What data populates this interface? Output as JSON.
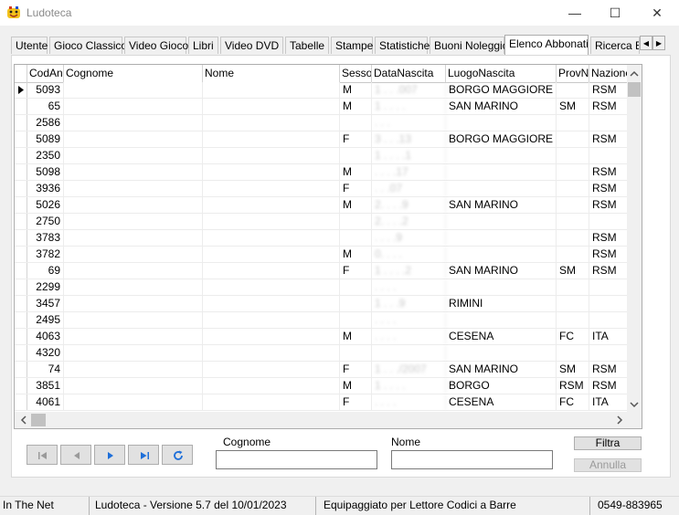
{
  "window": {
    "title": "Ludoteca",
    "minimize": "—",
    "maximize": "☐",
    "close": "✕"
  },
  "tabs": [
    {
      "label": "Utente"
    },
    {
      "label": "Gioco Classico"
    },
    {
      "label": "Video Gioco"
    },
    {
      "label": "Libri"
    },
    {
      "label": "Video DVD"
    },
    {
      "label": "Tabelle"
    },
    {
      "label": "Stampe"
    },
    {
      "label": "Statistiche"
    },
    {
      "label": "Buoni Noleggio"
    },
    {
      "label": "Elenco Abbonati"
    },
    {
      "label": "Ricerca E"
    }
  ],
  "active_tab": "Elenco Abbonati",
  "grid": {
    "columns": [
      "CodAna",
      "Cognome",
      "Nome",
      "Sesso",
      "DataNascita",
      "LuogoNascita",
      "ProvN",
      "Nazione"
    ],
    "rows": [
      {
        "cod": "5093",
        "sesso": "M",
        "data": "1 . . .007",
        "luogo": "BORGO MAGGIORE",
        "prov": "",
        "naz": "RSM"
      },
      {
        "cod": "65",
        "sesso": "M",
        "data": "1 . . . .",
        "luogo": "SAN MARINO",
        "prov": "SM",
        "naz": "RSM"
      },
      {
        "cod": "2586",
        "sesso": "",
        "data": ". . .",
        "luogo": "",
        "prov": "",
        "naz": ""
      },
      {
        "cod": "5089",
        "sesso": "F",
        "data": "3 . . .13",
        "luogo": "BORGO MAGGIORE",
        "prov": "",
        "naz": "RSM"
      },
      {
        "cod": "2350",
        "sesso": "",
        "data": "1 . . . .1",
        "luogo": "",
        "prov": "",
        "naz": ""
      },
      {
        "cod": "5098",
        "sesso": "M",
        "data": ". . . .17",
        "luogo": "",
        "prov": "",
        "naz": "RSM"
      },
      {
        "cod": "3936",
        "sesso": "F",
        "data": ". . .07",
        "luogo": "",
        "prov": "",
        "naz": "RSM"
      },
      {
        "cod": "5026",
        "sesso": "M",
        "data": "2. . . .9",
        "luogo": "SAN MARINO",
        "prov": "",
        "naz": "RSM"
      },
      {
        "cod": "2750",
        "sesso": "",
        "data": "2. . . .2",
        "luogo": "",
        "prov": "",
        "naz": ""
      },
      {
        "cod": "3783",
        "sesso": "",
        "data": ". . . .9",
        "luogo": "",
        "prov": "",
        "naz": "RSM"
      },
      {
        "cod": "3782",
        "sesso": "M",
        "data": "0. . . .",
        "luogo": "",
        "prov": "",
        "naz": "RSM"
      },
      {
        "cod": "69",
        "sesso": "F",
        "data": "1 . . . .2",
        "luogo": "SAN MARINO",
        "prov": "SM",
        "naz": "RSM"
      },
      {
        "cod": "2299",
        "sesso": "",
        "data": ". . . .",
        "luogo": "",
        "prov": "",
        "naz": ""
      },
      {
        "cod": "3457",
        "sesso": "",
        "data": "1 . . .9",
        "luogo": "RIMINI",
        "prov": "",
        "naz": ""
      },
      {
        "cod": "2495",
        "sesso": "",
        "data": ". . . .",
        "luogo": "",
        "prov": "",
        "naz": ""
      },
      {
        "cod": "4063",
        "sesso": "M",
        "data": ". . . .",
        "luogo": "CESENA",
        "prov": "FC",
        "naz": "ITA"
      },
      {
        "cod": "4320",
        "sesso": "",
        "data": "",
        "luogo": "",
        "prov": "",
        "naz": ""
      },
      {
        "cod": "74",
        "sesso": "F",
        "data": "1 . . ./2007",
        "luogo": "SAN MARINO",
        "prov": "SM",
        "naz": "RSM"
      },
      {
        "cod": "3851",
        "sesso": "M",
        "data": "1 . . . .",
        "luogo": "BORGO",
        "prov": "RSM",
        "naz": "RSM"
      },
      {
        "cod": "4061",
        "sesso": "F",
        "data": ". . . .",
        "luogo": "CESENA",
        "prov": "FC",
        "naz": "ITA"
      }
    ]
  },
  "filter": {
    "cognome_label": "Cognome",
    "nome_label": "Nome",
    "cognome_value": "",
    "nome_value": "",
    "filtra_label": "Filtra",
    "annulla_label": "Annulla"
  },
  "status": {
    "company": "In The Net",
    "version": "Ludoteca - Versione 5.7 del 10/01/2023",
    "feature": "Equipaggiato per Lettore Codici a Barre",
    "phone": "0549-883965"
  },
  "colors": {
    "accent_nav": "#1e6fd9"
  }
}
